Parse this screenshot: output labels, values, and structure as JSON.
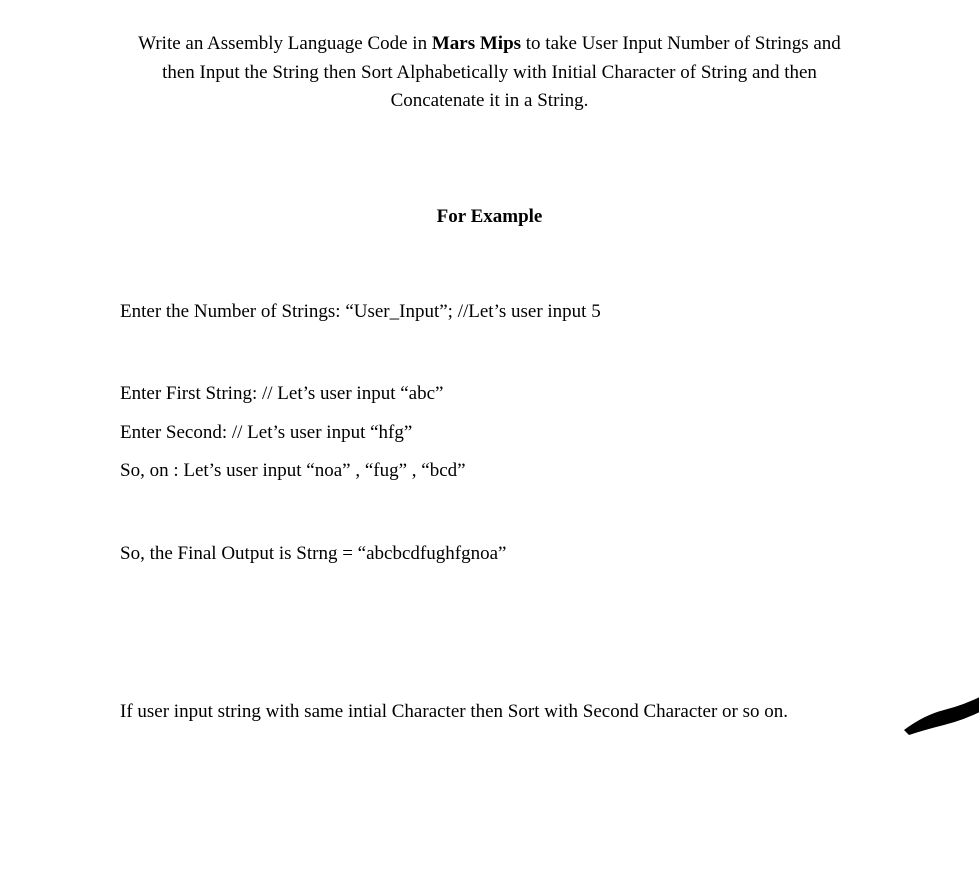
{
  "header": {
    "line1_pre": "Write an Assembly Language Code in ",
    "line1_bold": "Mars Mips",
    "line1_post": " to take User Input Number of Strings and then Input the String then Sort Alphabetically with Initial Character of String and then Concatenate it in a String."
  },
  "forExample": "For Example",
  "lines": {
    "l1": "Enter the Number of Strings: “User_Input”; //Let’s user input 5",
    "l2": "Enter First String: // Let’s user input “abc”",
    "l3": "Enter Second: // Let’s user input “hfg”",
    "l4": "So, on : Let’s user input “noa” , “fug” , “bcd”",
    "l5": "So, the Final Output is Strng = “abcbcdfughfgnoa”",
    "l6": "If user input string with same intial Character then Sort with Second Character or so on."
  }
}
